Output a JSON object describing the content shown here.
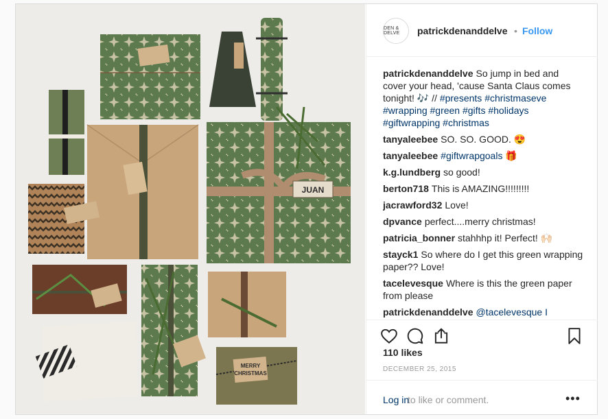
{
  "header": {
    "avatar_text": "DEN & DELVE",
    "username": "patrickdenanddelve",
    "separator": "•",
    "follow_label": "Follow"
  },
  "photo": {
    "tag_juan": "JUAN",
    "tag_merry": "MERRY",
    "tag_christmas": "CHRISTMAS"
  },
  "caption": {
    "user": "patrickdenanddelve",
    "text": "So jump in bed and cover your head, 'cause Santa Claus comes tonight! 🎶 //",
    "hashtags": [
      "#presents",
      "#christmaseve",
      "#wrapping",
      "#green",
      "#gifts",
      "#holidays",
      "#giftwrapping",
      "#christmas"
    ]
  },
  "comments": [
    {
      "user": "tanyaleebee",
      "text": "SO. SO. GOOD. 😍"
    },
    {
      "user": "tanyaleebee",
      "text": "#giftwrapgoals 🎁"
    },
    {
      "user": "k.g.lundberg",
      "text": "so good!"
    },
    {
      "user": "berton718",
      "text": "This is AMAZING!!!!!!!!!"
    },
    {
      "user": "jacrawford32",
      "text": "Love!"
    },
    {
      "user": "dpvance",
      "text": "perfect....merry christmas!"
    },
    {
      "user": "patricia_bonner",
      "text": "stahhhp it! Perfect! 🙌🏻"
    },
    {
      "user": "stayck1",
      "text": "So where do I get this green wrapping paper?? Love!"
    },
    {
      "user": "tacelevesque",
      "text": "Where is this the green paper from please"
    },
    {
      "user": "patrickdenanddelve",
      "text": "@tacelevesque I"
    }
  ],
  "actions": {
    "like_icon": "heart-icon",
    "comment_icon": "comment-icon",
    "share_icon": "share-icon",
    "save_icon": "bookmark-icon"
  },
  "likes": "110 likes",
  "date": "DECEMBER 25, 2015",
  "footer": {
    "login_label": "Log in",
    "login_rest": "to like or comment.",
    "more_label": "•••"
  },
  "colors": {
    "accent": "#3897f0",
    "link": "#003569",
    "muted": "#999999",
    "border": "#efefef"
  }
}
